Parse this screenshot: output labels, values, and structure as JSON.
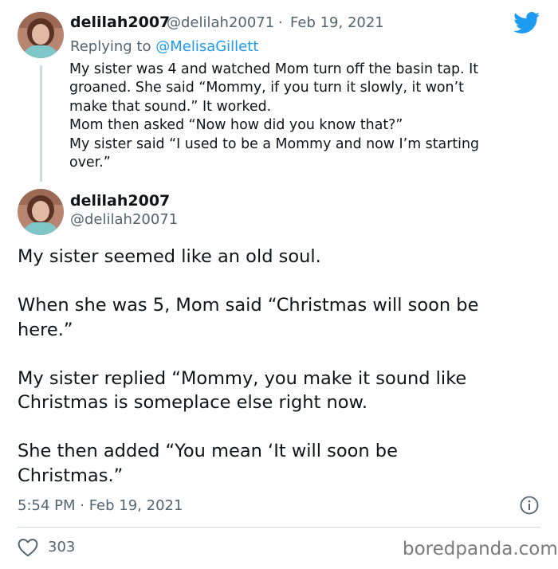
{
  "reply_tweet": {
    "display_name": "delilah2007",
    "handle": "@delilah20071",
    "separator": "·",
    "date": "Feb 19, 2021",
    "replying_prefix": "Replying to",
    "replying_to": "@MelisaGillett",
    "lines": [
      "My sister was 4 and  watched Mom turn off the basin tap. It",
      "groaned. She said “Mommy, if you turn it slowly,  it won’t",
      "make that sound.”  It worked.",
      "Mom then asked “Now how did you know that?”",
      "My sister said “I used to be a Mommy and now I’m starting",
      "over.”"
    ]
  },
  "main_tweet": {
    "display_name": "delilah2007",
    "handle": "@delilah20071",
    "paragraphs": [
      [
        "My sister seemed like an old soul."
      ],
      [
        "When she was 5, Mom said “Christmas will soon be",
        "here.”"
      ],
      [
        "My sister replied “Mommy, you make it sound like",
        "Christmas is someplace else right now."
      ],
      [
        "She then added “You mean ‘It will soon be",
        "Christmas.”"
      ]
    ],
    "timestamp": "5:54 PM · Feb 19, 2021",
    "likes": "303"
  },
  "watermark": "boredpanda.com",
  "icons": {
    "brand": "twitter-bird-icon",
    "info": "info-icon",
    "like": "heart-icon"
  },
  "colors": {
    "twitter_blue": "#1d9bf0",
    "muted": "#536471",
    "text": "#0f1419"
  }
}
